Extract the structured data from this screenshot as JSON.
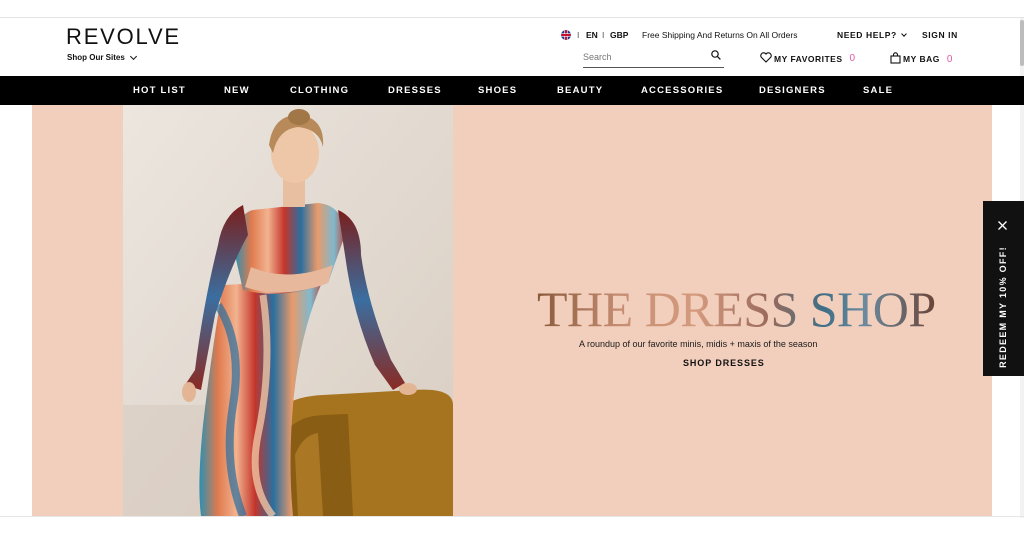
{
  "header": {
    "logo": "REVOLVE",
    "shop_sites": "Shop Our Sites",
    "utility": {
      "sep1": "I",
      "language": "EN",
      "sep2": "I",
      "currency": "GBP",
      "shipping": "Free Shipping And Returns On All Orders",
      "need_help": "NEED HELP?",
      "sign_in": "SIGN IN"
    },
    "search": {
      "placeholder": "Search"
    },
    "favorites": {
      "label": "MY FAVORITES",
      "count": "0"
    },
    "bag": {
      "label": "MY BAG",
      "count": "0"
    }
  },
  "nav": {
    "items": [
      "HOT LIST",
      "NEW",
      "CLOTHING",
      "DRESSES",
      "SHOES",
      "BEAUTY",
      "ACCESSORIES",
      "DESIGNERS",
      "SALE"
    ]
  },
  "hero": {
    "title": "THE DRESS SHOP",
    "subtitle": "A roundup of our favorite minis, midis + maxis of the season",
    "cta": "SHOP DRESSES"
  },
  "redeem": {
    "label": "REDEEM MY 10% OFF!"
  },
  "colors": {
    "nav_bg": "#000000",
    "hero_bg": "#f2cfbc",
    "count_accent": "#e05aa5",
    "redeem_bg": "#111111"
  },
  "icons": [
    "uk-flag-icon",
    "chevron-down-icon",
    "search-icon",
    "heart-icon",
    "bag-icon",
    "close-icon"
  ]
}
